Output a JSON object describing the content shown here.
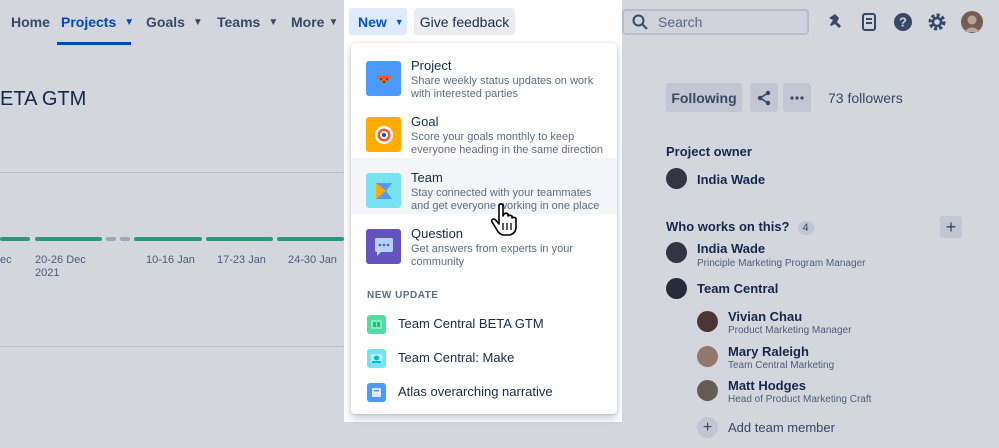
{
  "nav": {
    "home": "Home",
    "projects": "Projects",
    "goals": "Goals",
    "teams": "Teams",
    "more": "More",
    "new": "New",
    "give_feedback": "Give feedback",
    "search_placeholder": "Search"
  },
  "project": {
    "title": "ETA GTM"
  },
  "timeline": {
    "labels": [
      "ec",
      "20-26 Dec",
      "2021",
      "10-16 Jan",
      "17-23 Jan",
      "24-30 Jan"
    ]
  },
  "dropdown": {
    "items": [
      {
        "title": "Project",
        "description": "Share weekly status updates on work with interested parties",
        "icon": "watermelon-icon"
      },
      {
        "title": "Goal",
        "description": "Score your goals monthly to keep everyone heading in the same direction",
        "icon": "target-icon"
      },
      {
        "title": "Team",
        "description": "Stay connected with your teammates and get everyone working in one place",
        "icon": "team-flag-icon"
      },
      {
        "title": "Question",
        "description": "Get answers from experts in your community",
        "icon": "speech-bubble-icon"
      }
    ],
    "new_update_heading": "NEW UPDATE",
    "updates": [
      {
        "label": "Team Central BETA GTM",
        "icon": "project-thumbnail-icon"
      },
      {
        "label": "Team Central: Make",
        "icon": "project-thumbnail-icon"
      },
      {
        "label": "Atlas overarching narrative",
        "icon": "project-thumbnail-icon"
      }
    ]
  },
  "sidebar": {
    "following": "Following",
    "followers": "73 followers",
    "project_owner_heading": "Project owner",
    "owner_name": "India Wade",
    "who_works_heading": "Who works on this?",
    "who_works_count": "4",
    "people": [
      {
        "name": "India Wade",
        "role": "Principle Marketing Program Manager"
      },
      {
        "name": "Team Central",
        "role": ""
      },
      {
        "name": "Vivian Chau",
        "role": "Product Marketing Manager"
      },
      {
        "name": "Mary Raleigh",
        "role": "Team Central Marketing"
      },
      {
        "name": "Matt Hodges",
        "role": "Head of Product Marketing Craft"
      }
    ],
    "add_member": "Add team member"
  },
  "colors": {
    "accent": "#0052cc",
    "timeline_green": "#36b37e",
    "dim_overlay": "rgba(9,30,66,0.18)"
  }
}
